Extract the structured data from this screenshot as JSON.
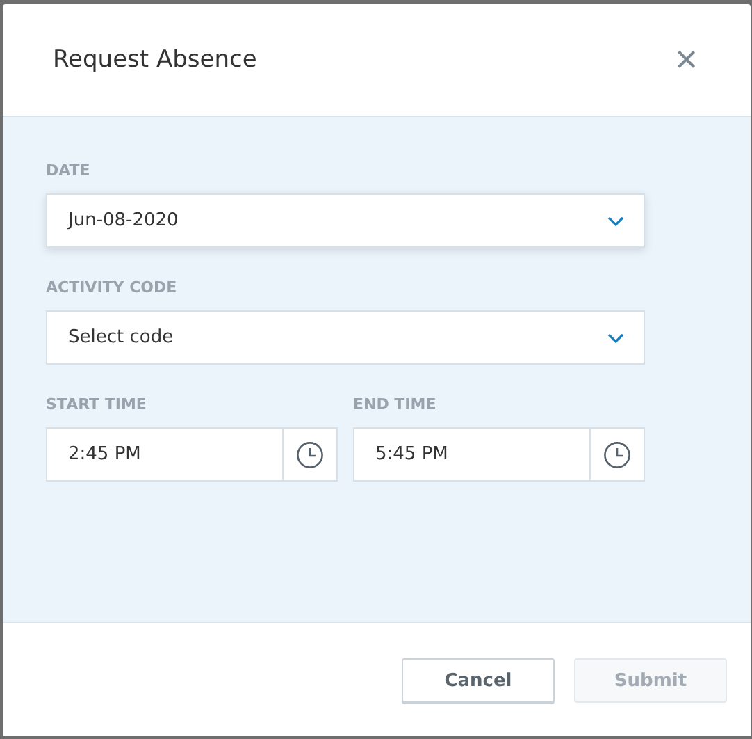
{
  "dialog": {
    "title": "Request Absence",
    "close": "×"
  },
  "dropdowns": [
    {
      "label": "DATE",
      "value": "Jun-08-2020",
      "focused": true
    },
    {
      "label": "ACTIVITY CODE",
      "placeholder": "Select  code",
      "focused": false
    }
  ],
  "times": [
    {
      "label": "START TIME",
      "value": "2:45 PM"
    },
    {
      "label": "END TIME",
      "value": "5:45 PM"
    }
  ],
  "buttons": [
    {
      "label": "Cancel",
      "disabled": false
    },
    {
      "label": "Submit",
      "disabled": true
    }
  ]
}
